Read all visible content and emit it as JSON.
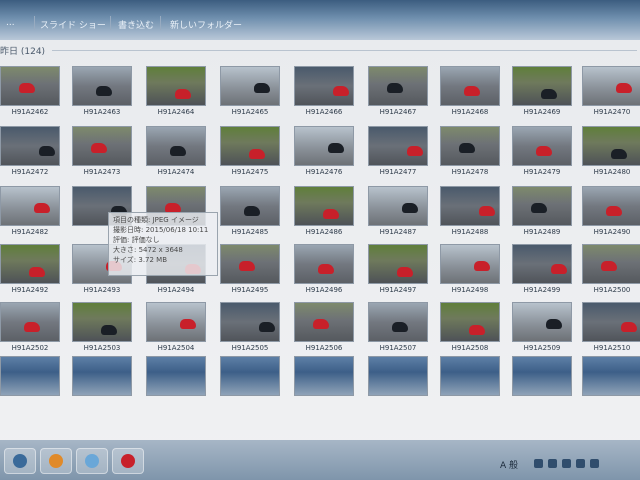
{
  "toolbar": {
    "items": [
      "...",
      "スライド ショー",
      "書き込む",
      "新しいフォルダー"
    ]
  },
  "group_label": "昨日 (124)",
  "tooltip": {
    "type": "項目の種類: JPEG イメージ",
    "date": "撮影日時: 2015/06/18 10:11",
    "rating": "評価: 評価なし",
    "dimensions": "大きさ: 5472 x 3648",
    "size": "サイズ: 3.72 MB"
  },
  "rows": [
    [
      "H91A2462",
      "H91A2463",
      "H91A2464",
      "H91A2465",
      "H91A2466",
      "H91A2467",
      "H91A2468",
      "H91A2469",
      "H91A2470"
    ],
    [
      "H91A2472",
      "H91A2473",
      "H91A2474",
      "H91A2475",
      "H91A2476",
      "H91A2477",
      "H91A2478",
      "H91A2479",
      "H91A2480"
    ],
    [
      "H91A2482",
      "",
      "",
      "H91A2485",
      "H91A2486",
      "H91A2487",
      "H91A2488",
      "H91A2489",
      "H91A2490"
    ],
    [
      "H91A2492",
      "H91A2493",
      "H91A2494",
      "H91A2495",
      "H91A2496",
      "H91A2497",
      "H91A2498",
      "H91A2499",
      "H91A2500"
    ],
    [
      "H91A2502",
      "H91A2503",
      "H91A2504",
      "H91A2505",
      "H91A2506",
      "H91A2507",
      "H91A2508",
      "H91A2509",
      "H91A2510"
    ],
    [
      "",
      "",
      "",
      "",
      "",
      "",
      "",
      "",
      ""
    ]
  ],
  "tray": {
    "ime": "A 般"
  },
  "colors": {
    "bike_red": "#c8202a",
    "bike_dark": "#1a1f26",
    "track_gray": "#6d7176",
    "grass": "#5f7f3b"
  }
}
